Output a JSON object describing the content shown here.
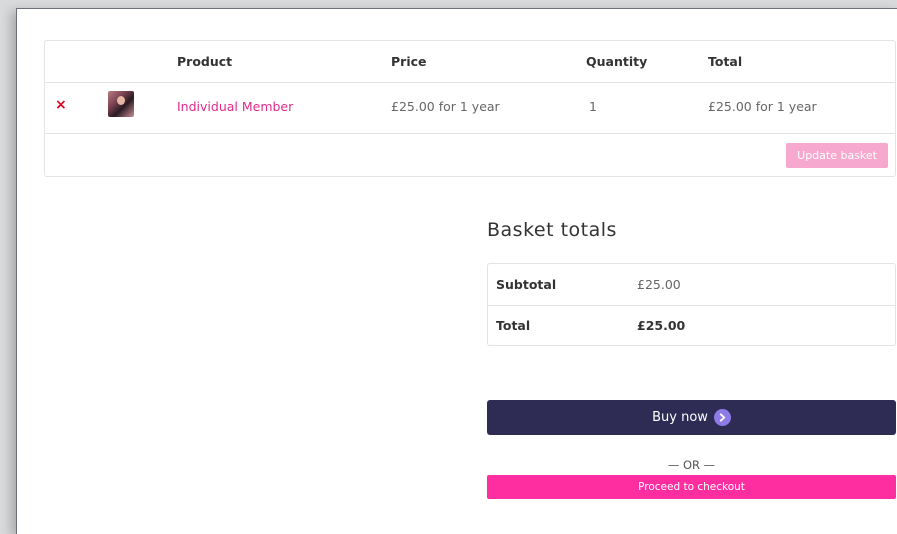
{
  "cart": {
    "headers": {
      "product": "Product",
      "price": "Price",
      "quantity": "Quantity",
      "total": "Total"
    },
    "items": [
      {
        "remove_symbol": "×",
        "thumbnail_icon": "member-photo",
        "product": "Individual Member",
        "price": "£25.00 for 1 year",
        "quantity": "1",
        "total": "£25.00 for 1 year"
      }
    ],
    "update_label": "Update basket"
  },
  "totals": {
    "title": "Basket totals",
    "subtotal_label": "Subtotal",
    "subtotal_value": "£25.00",
    "total_label": "Total",
    "total_value": "£25.00"
  },
  "actions": {
    "buy_now_label": "Buy now",
    "buy_now_icon": "chevron-right-circle-icon",
    "or_text": "— OR —",
    "checkout_label": "Proceed to checkout"
  },
  "colors": {
    "link": "#e02b8a",
    "remove": "#e2001a",
    "update_button": "#f6a8cf",
    "buy_now_button": "#2e2b55",
    "checkout_button": "#ff2ea0"
  }
}
